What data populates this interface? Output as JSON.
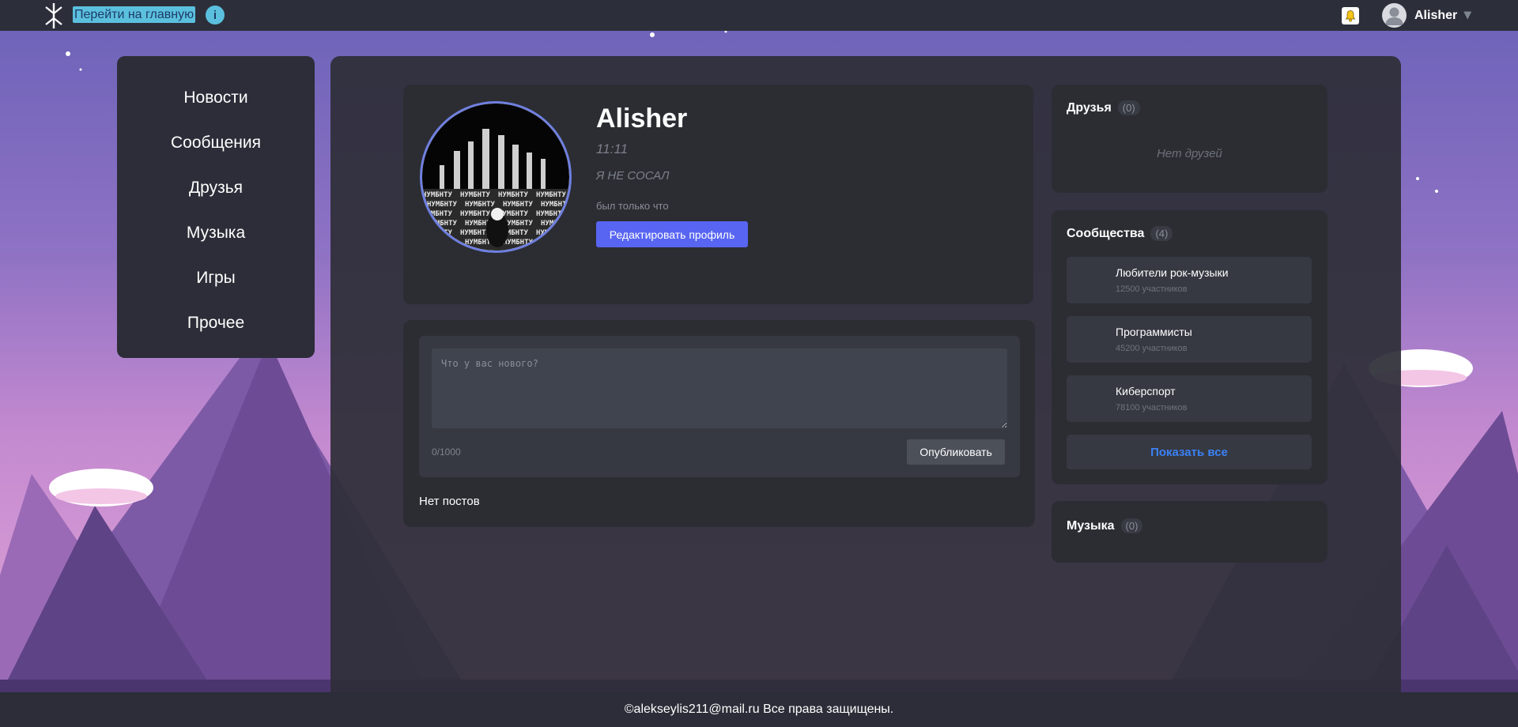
{
  "topbar": {
    "home_link": "Перейти на главную",
    "info_label": "i",
    "user_name": "Alisher",
    "caret": "▼"
  },
  "sidebar": {
    "items": [
      {
        "label": "Новости"
      },
      {
        "label": "Сообщения"
      },
      {
        "label": "Друзья"
      },
      {
        "label": "Музыка"
      },
      {
        "label": "Игры"
      },
      {
        "label": "Прочее"
      }
    ]
  },
  "profile": {
    "name": "Alisher",
    "time": "11:11",
    "status": "Я НЕ СОСАЛ",
    "last_seen": "был только что",
    "edit_button": "Редактировать профиль",
    "avatar_text": "НУМБНТУ"
  },
  "composer": {
    "placeholder": "Что у вас нового?",
    "counter": "0/1000",
    "publish_button": "Опубликовать",
    "no_posts": "Нет постов"
  },
  "friends": {
    "title": "Друзья",
    "count": "(0)",
    "empty": "Нет друзей"
  },
  "communities": {
    "title": "Сообщества",
    "count": "(4)",
    "items": [
      {
        "name": "Любители рок-музыки",
        "members": "12500 участников"
      },
      {
        "name": "Программисты",
        "members": "45200 участников"
      },
      {
        "name": "Киберспорт",
        "members": "78100 участников"
      }
    ],
    "show_all": "Показать все"
  },
  "music": {
    "title": "Музыка",
    "count": "(0)"
  },
  "footer": {
    "text": "©alekseylis211@mail.ru Все права защищены."
  },
  "colors": {
    "accent": "#5865f2",
    "link_blue": "#3b82f6",
    "info_cyan": "#5bc0de",
    "panel": "#2b2d33"
  },
  "icons": {
    "logo": "rune-logo-icon",
    "info": "info-icon",
    "bell": "bell-icon",
    "avatar": "user-avatar-icon"
  }
}
